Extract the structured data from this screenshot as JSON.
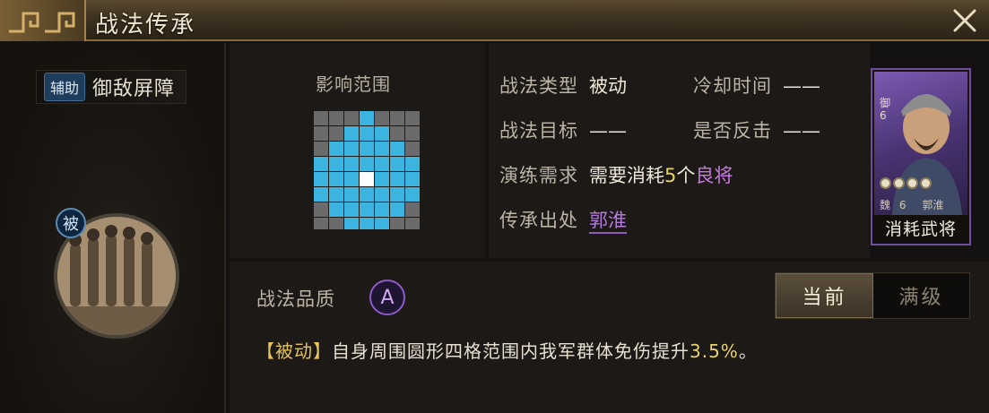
{
  "title_bar": {
    "title": "战法传承",
    "close_icon": "close-icon"
  },
  "skill": {
    "type_chip": "辅助",
    "name": "御敌屏障",
    "passive_badge": "被"
  },
  "range": {
    "label": "影响范围",
    "grid_size": 7,
    "highlight_radius": 4,
    "colors": {
      "cell_off": "#6b6b6b",
      "cell_on": "#3cb4e0",
      "center": "#ffffff"
    }
  },
  "info": {
    "type_label": "战法类型",
    "type_value": "被动",
    "cooldown_label": "冷却时间",
    "cooldown_value": "——",
    "target_label": "战法目标",
    "target_value": "——",
    "counter_label": "是否反击",
    "counter_value": "——",
    "drill_label": "演练需求",
    "drill_prefix": "需要消耗",
    "drill_count": "5",
    "drill_unit": "个",
    "drill_item": "良将",
    "origin_label": "传承出处",
    "origin_value": "郭淮"
  },
  "card": {
    "caption": "消耗武将",
    "rank_char": "御",
    "rank_num": "6",
    "faction": "魏",
    "cost": "6",
    "name": "郭淮",
    "stars": 4
  },
  "quality": {
    "label": "战法品质",
    "grade": "A"
  },
  "level_toggle": {
    "current": "当前",
    "max": "满级"
  },
  "description": {
    "tag": "【被动】",
    "text": "自身周围圆形四格范围内我军群体免伤提升",
    "value": "3.5%",
    "end": "。"
  }
}
